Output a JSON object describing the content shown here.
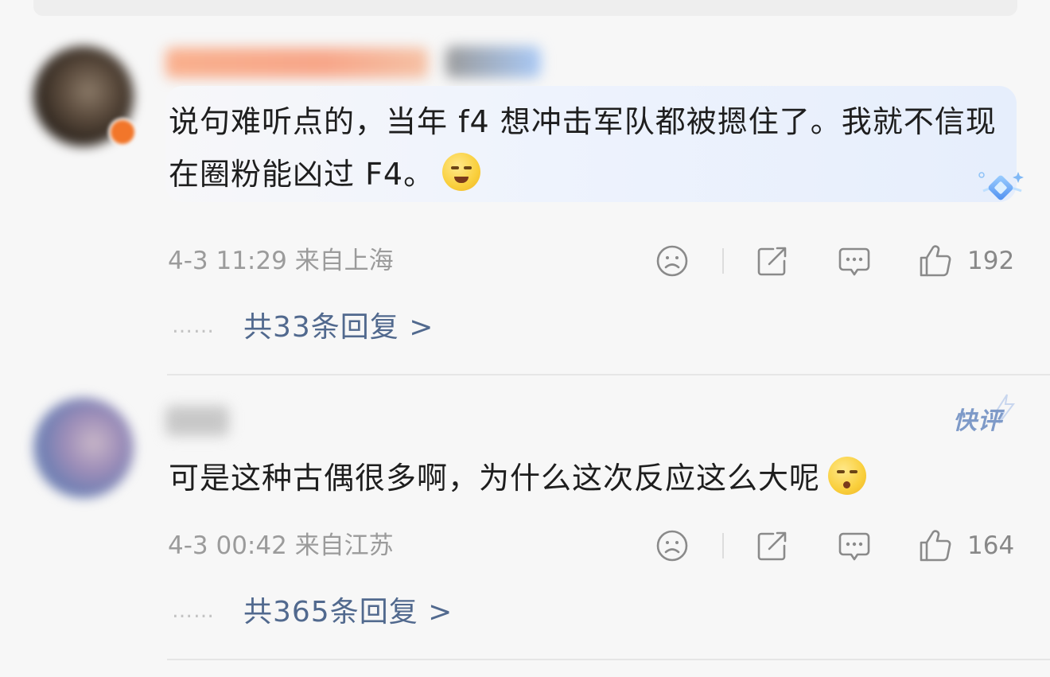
{
  "comments": [
    {
      "text": "说句难听点的，当年 f4 想冲击军队都被摁住了。我就不信现在圈粉能凶过 F4。",
      "emoji": "laugh-cry-emoji",
      "timestamp": "4-3 11:29",
      "location": "来自上海",
      "likes": "192",
      "replies": "共33条回复 >"
    },
    {
      "text": "可是这种古偶很多啊，为什么这次反应这么大呢",
      "emoji": "shush-emoji",
      "timestamp": "4-3 00:42",
      "location": "来自江苏",
      "likes": "164",
      "replies": "共365条回复 >",
      "badge": "快评"
    }
  ],
  "reply_dots": "……",
  "icons": {
    "dislike": "sad-face-icon",
    "share": "share-icon",
    "comment": "comment-icon",
    "like": "thumbs-up-icon"
  },
  "colors": {
    "link": "#51698e",
    "meta": "#9b9b9b",
    "badge": "#7e9ac8"
  }
}
